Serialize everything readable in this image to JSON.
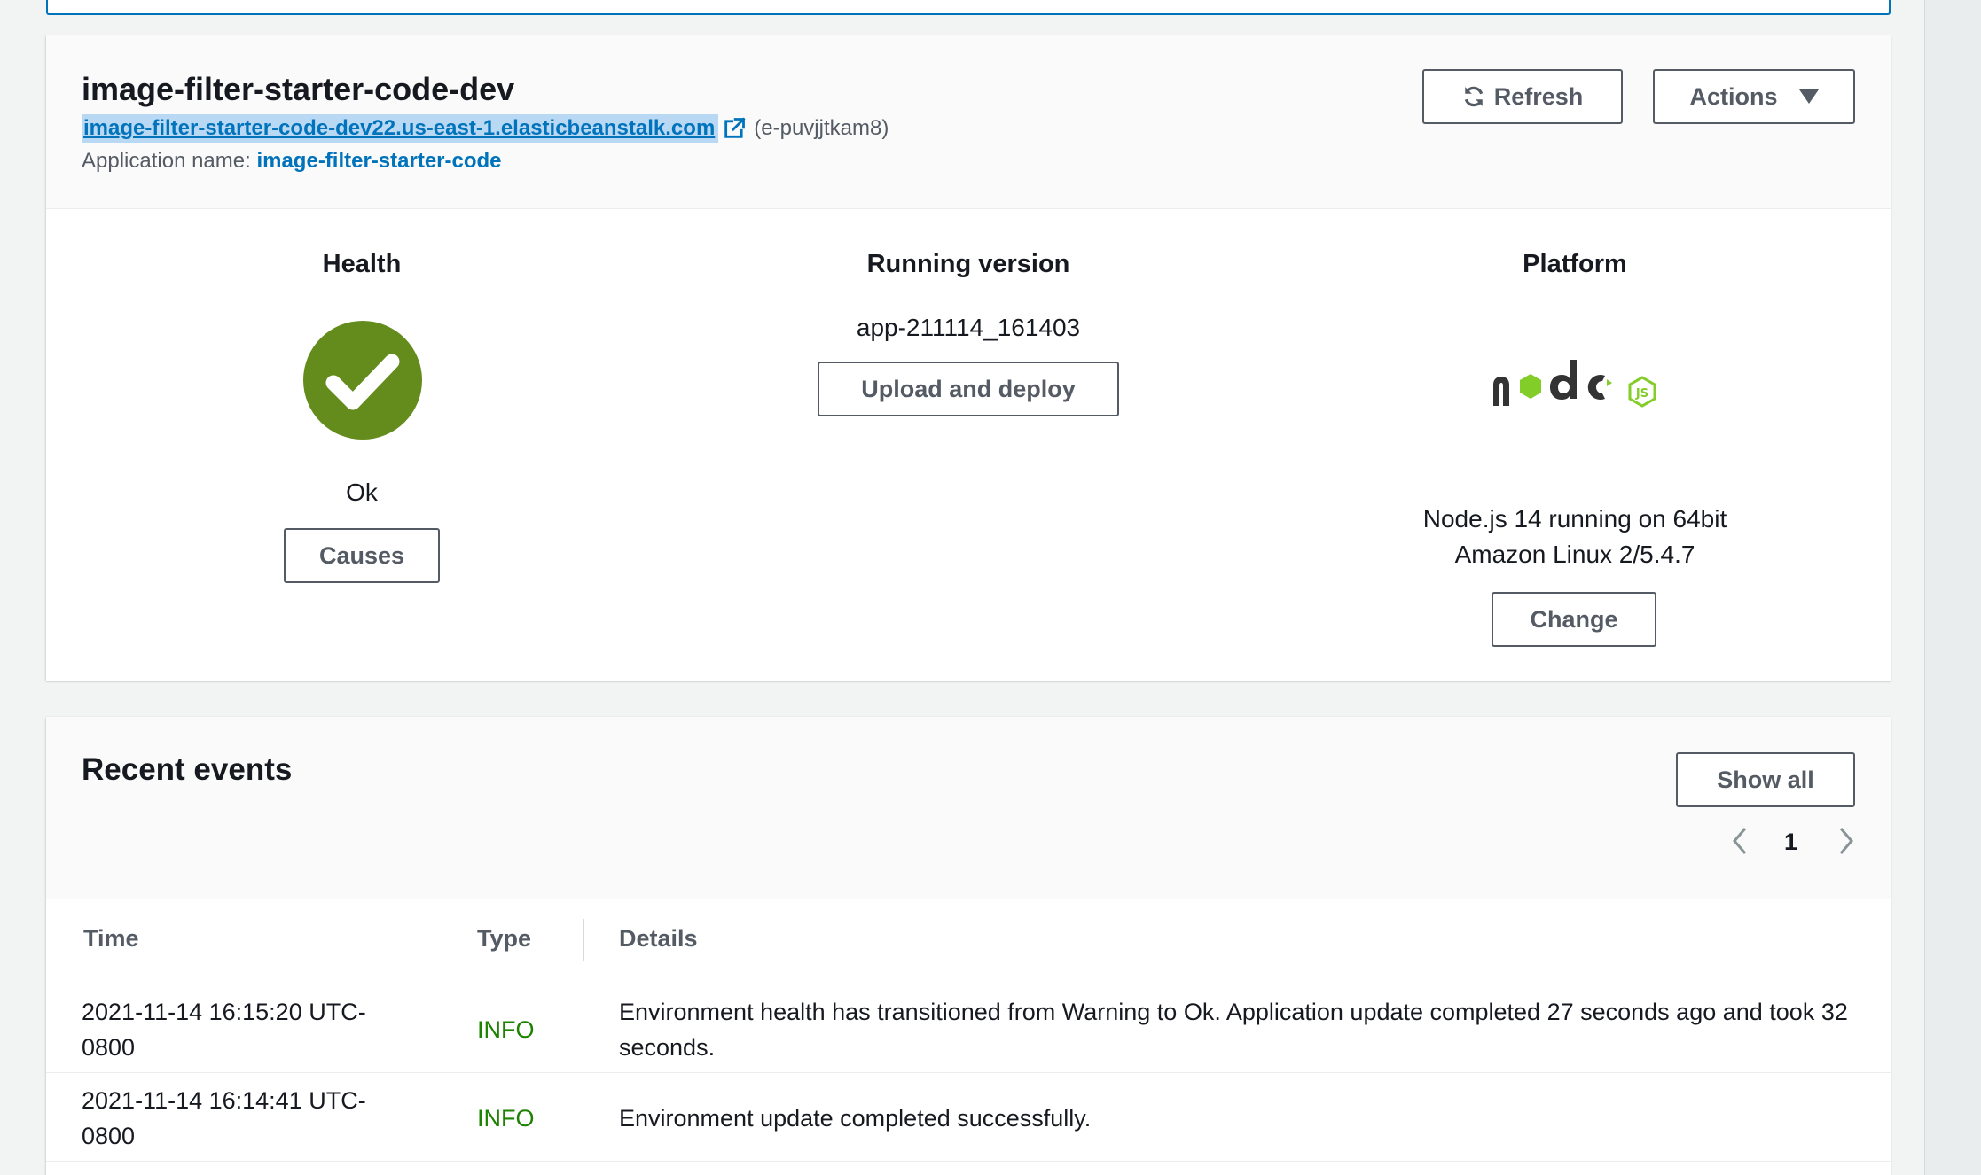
{
  "environment": {
    "name": "image-filter-starter-code-dev",
    "url": "image-filter-starter-code-dev22.us-east-1.elasticbeanstalk.com",
    "env_id": "(e-puvjjtkam8)",
    "app_label": "Application name:",
    "app_name": "image-filter-starter-code",
    "buttons": {
      "refresh": "Refresh",
      "actions": "Actions"
    }
  },
  "health": {
    "title": "Health",
    "status": "Ok",
    "status_color": "#638c1c",
    "causes_label": "Causes"
  },
  "running_version": {
    "title": "Running version",
    "version": "app-211114_161403",
    "upload_label": "Upload and deploy"
  },
  "platform": {
    "title": "Platform",
    "logo": "nodejs-logo",
    "line1": "Node.js 14 running on 64bit",
    "line2": "Amazon Linux 2/5.4.7",
    "change_label": "Change"
  },
  "events": {
    "title": "Recent events",
    "show_all_label": "Show all",
    "page": "1",
    "columns": [
      "Time",
      "Type",
      "Details"
    ],
    "rows": [
      {
        "time": "2021-11-14 16:15:20 UTC-0800",
        "type": "INFO",
        "details": "Environment health has transitioned from Warning to Ok. Application update completed 27 seconds ago and took 32 seconds."
      },
      {
        "time": "2021-11-14 16:14:41 UTC-0800",
        "type": "INFO",
        "details": "Environment update completed successfully."
      }
    ]
  },
  "colors": {
    "link": "#0073bb",
    "info": "#1d8102",
    "button_border": "#545b64",
    "nodejs_green": "#83cd29"
  }
}
